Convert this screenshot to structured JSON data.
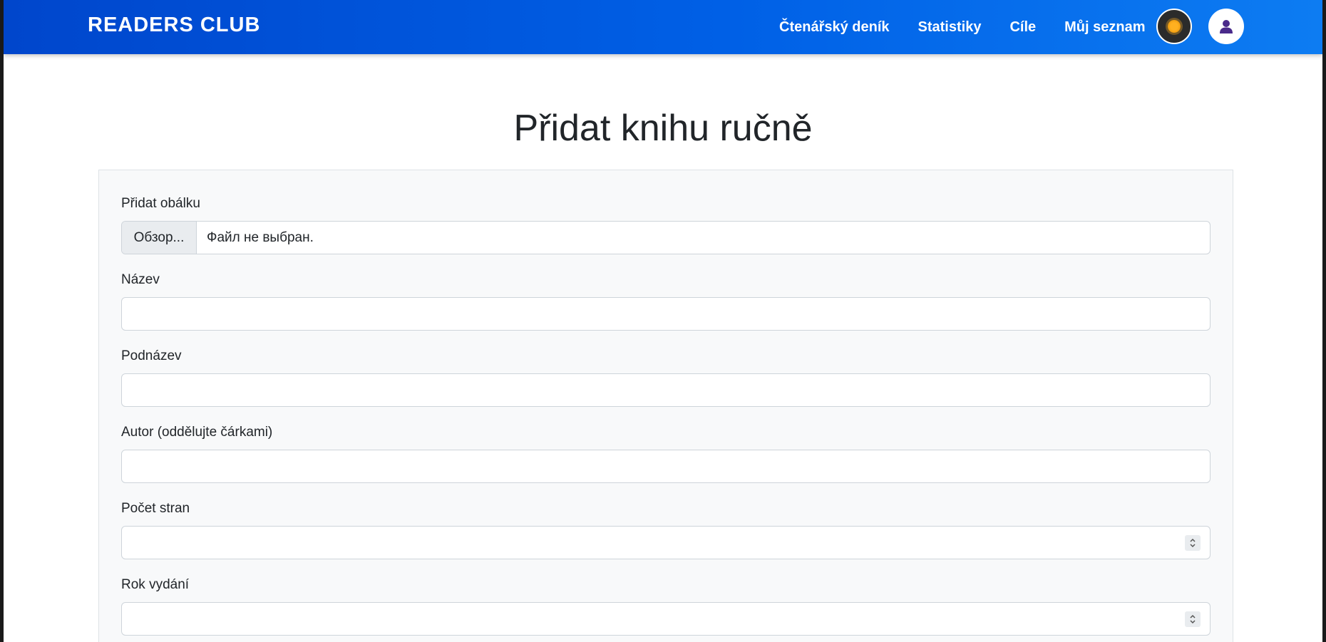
{
  "navbar": {
    "brand": "READERS CLUB",
    "links": [
      "Čtenářský deník",
      "Statistiky",
      "Cíle",
      "Můj seznam"
    ],
    "theme_icon": "sun-icon",
    "user_icon": "user-icon"
  },
  "page": {
    "title": "Přidat knihu ručně"
  },
  "form": {
    "cover": {
      "label": "Přidat obálku",
      "browse_label": "Обзор...",
      "status": "Файл не выбран."
    },
    "title_field": {
      "label": "Název",
      "value": ""
    },
    "subtitle_field": {
      "label": "Podnázev",
      "value": ""
    },
    "author_field": {
      "label": "Autor (oddělujte čárkami)",
      "value": ""
    },
    "pages_field": {
      "label": "Počet stran",
      "value": ""
    },
    "year_field": {
      "label": "Rok vydání",
      "value": ""
    }
  },
  "colors": {
    "navbar_start": "#0046cc",
    "navbar_end": "#0d7cf2",
    "card_bg": "#f8f9fa",
    "text": "#212529",
    "user_icon": "#4a2a8a"
  }
}
